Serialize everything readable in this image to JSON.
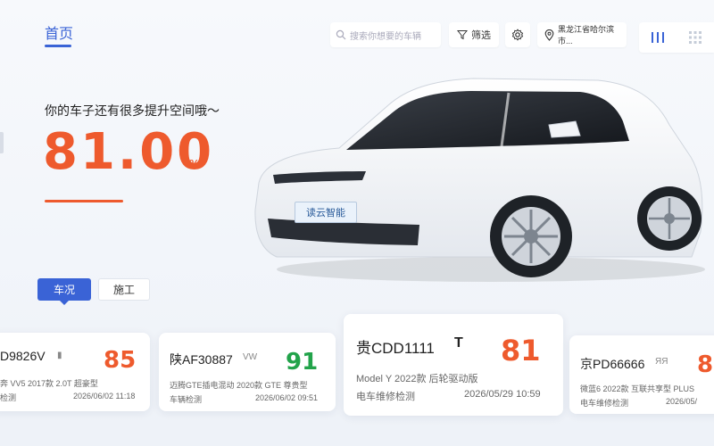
{
  "header": {
    "tab_home": "首页",
    "search_placeholder": "搜索你想要的车辆",
    "filter_label": "筛选",
    "location_label": "黑龙江省哈尔滨市..."
  },
  "hero": {
    "subtitle": "你的车子还有很多提升空间哦～",
    "score": "81.00",
    "score_unit": "%",
    "car_sign_text": "读云智能"
  },
  "segments": {
    "condition": "车况",
    "construction": "施工"
  },
  "cards": [
    {
      "plate": "D9826V",
      "brand_mark": "▮",
      "value": "85",
      "value_color": "#ee5a2d",
      "desc": "奔 VV5 2017款 2.0T 超豪型",
      "type": "检测",
      "time": "2026/06/02 11:18"
    },
    {
      "plate": "陕AF30887",
      "brand_mark": "VW",
      "value": "91",
      "value_color": "#22a34a",
      "desc": "迈腾GTE插电混动 2020款 GTE 尊贵型",
      "type": "车辆检测",
      "time": "2026/06/02 09:51"
    },
    {
      "plate": "贵CDD1111",
      "brand_mark": "T",
      "value": "81",
      "value_color": "#ee5a2d",
      "desc": "Model Y 2022款 后轮驱动版",
      "type": "电车维修检测",
      "time": "2026/05/29 10:59"
    },
    {
      "plate": "京PD66666",
      "brand_mark": "ЯЯ",
      "value": "8",
      "value_color": "#ee5a2d",
      "desc": "微蓝6 2022款 互联共享型 PLUS",
      "type": "电车维修检测",
      "time": "2026/05/"
    }
  ],
  "colors": {
    "accent": "#3a63d6",
    "score_orange": "#ee5a2d",
    "score_green": "#22a34a"
  },
  "icons": [
    "search-icon",
    "filter-icon",
    "gear-icon",
    "location-pin-icon",
    "list-view-icon",
    "grid-view-icon"
  ]
}
